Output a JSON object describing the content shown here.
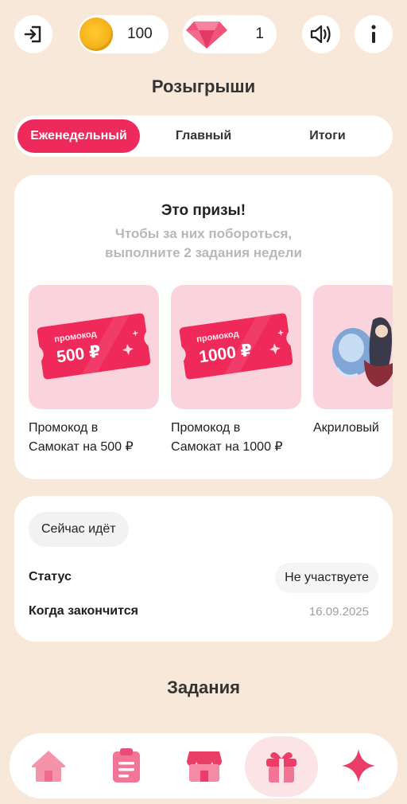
{
  "topbar": {
    "coins": "100",
    "gems": "1"
  },
  "page_title": "Розыгрыши",
  "tabs": [
    {
      "label": "Еженедельный",
      "active": true
    },
    {
      "label": "Главный",
      "active": false
    },
    {
      "label": "Итоги",
      "active": false
    }
  ],
  "prizes": {
    "title": "Это призы!",
    "subtitle_line1": "Чтобы за них побороться,",
    "subtitle_line2": "выполните 2 задания недели",
    "items": [
      {
        "ticket_label": "промокод",
        "ticket_value": "500 ₽",
        "name_line1": "Промокод в",
        "name_line2": "Самокат на 500 ₽"
      },
      {
        "ticket_label": "промокод",
        "ticket_value": "1000 ₽",
        "name_line1": "Промокод в",
        "name_line2": "Самокат на 1000 ₽"
      },
      {
        "name_line1": "Акриловый",
        "name_line2": ""
      }
    ]
  },
  "status_card": {
    "badge": "Сейчас идёт",
    "status_label": "Статус",
    "status_value": "Не участвуете",
    "ends_label": "Когда закончится",
    "ends_value": "16.09.2025"
  },
  "tasks_title": "Задания",
  "colors": {
    "background": "#f7e8d9",
    "accent": "#ee2a5d",
    "nav_icon": "#f06a8a"
  }
}
